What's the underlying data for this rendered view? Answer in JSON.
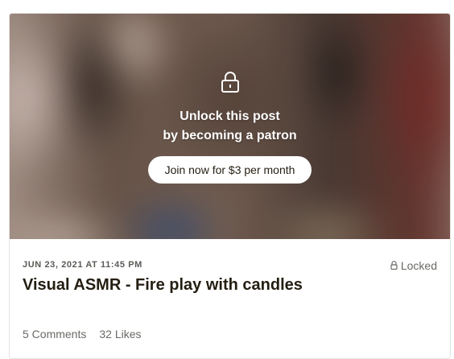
{
  "post": {
    "lock_overlay": {
      "line1": "Unlock this post",
      "line2": "by becoming a patron",
      "join_button": "Join now for $3 per month"
    },
    "date": "JUN 23, 2021 AT 11:45 PM",
    "status": "Locked",
    "title": "Visual ASMR - Fire play with candles",
    "comments": "5 Comments",
    "likes": "32 Likes"
  },
  "icons": {
    "overlay_lock": "lock-icon",
    "status_lock": "small-lock-icon"
  },
  "colors": {
    "title_text": "#241e12",
    "muted_text": "#6b6a65",
    "button_bg": "#ffffff"
  }
}
